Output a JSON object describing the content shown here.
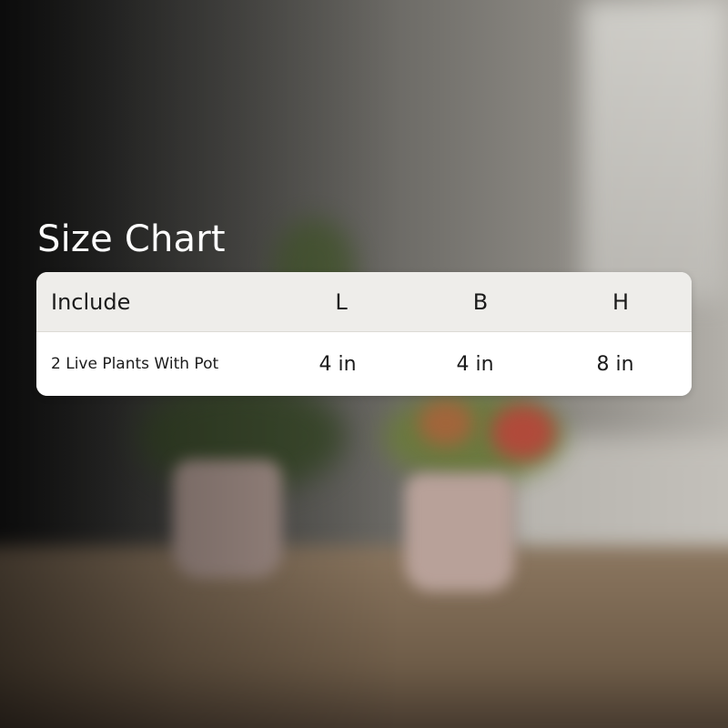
{
  "title": "Size Chart",
  "table": {
    "headers": [
      "Include",
      "L",
      "B",
      "H"
    ],
    "rows": [
      [
        "2 Live Plants With Pot",
        "4 in",
        "4 in",
        "8 in"
      ]
    ]
  },
  "colors": {
    "header_bg": "#eeedea",
    "row_bg": "#ffffff",
    "title_text": "#ffffff",
    "cell_text": "#1b1b1b"
  }
}
